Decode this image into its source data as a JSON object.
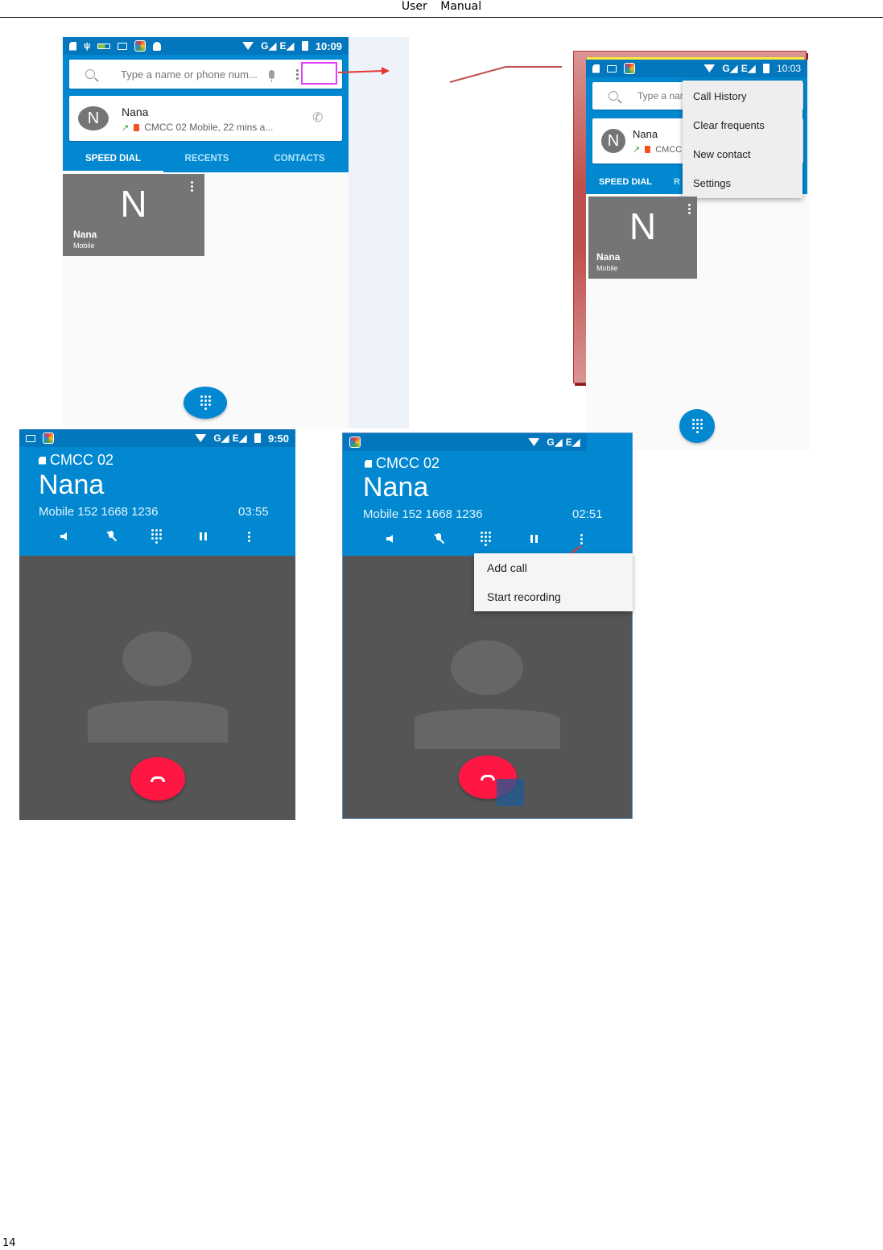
{
  "page": {
    "header_words": [
      "User",
      "Manual"
    ],
    "page_number": "14"
  },
  "colors": {
    "primary_blue": "#0288d1",
    "statusbar_blue": "#0277bd",
    "end_call_red": "#ff1744",
    "highlight_magenta": "#e040fb",
    "annotation_red": "#e53935"
  },
  "screen1": {
    "status_time": "10:09",
    "status_icons": [
      "sim-icon",
      "usb-icon",
      "battery-saver-icon",
      "gallery-icon",
      "app-icon",
      "android-icon"
    ],
    "status_network": "G◢ E◢",
    "search_placeholder": "Type a name or phone num...",
    "recent": {
      "avatar_letter": "N",
      "name": "Nana",
      "direction_glyph": "↗",
      "detail": "CMCC 02 Mobile, 22 mins a..."
    },
    "tabs": [
      {
        "label": "SPEED DIAL",
        "active": true
      },
      {
        "label": "RECENTS",
        "active": false
      },
      {
        "label": "CONTACTS",
        "active": false
      }
    ],
    "speed_dial": {
      "letter": "N",
      "name": "Nana",
      "type": "Mobile"
    }
  },
  "screen2": {
    "status_time": "10:03",
    "status_network": "G◢ E◢",
    "search_placeholder": "Type a name",
    "recent": {
      "avatar_letter": "N",
      "name": "Nana",
      "direction_glyph": "↗",
      "detail": "CMCC"
    },
    "tabs": [
      {
        "label": "SPEED DIAL",
        "active": true
      },
      {
        "label": "R",
        "active": false
      }
    ],
    "menu_items": [
      "Call History",
      "Clear frequents",
      "New contact",
      "Settings"
    ],
    "speed_dial": {
      "letter": "N",
      "name": "Nana",
      "type": "Mobile"
    }
  },
  "screen3": {
    "status_time": "9:50",
    "status_network": "G◢ E◢",
    "sim_label": "CMCC 02",
    "caller_name": "Nana",
    "caller_number": "Mobile 152 1668 1236",
    "call_timer": "03:55"
  },
  "screen4": {
    "status_network": "G◢ E◢",
    "sim_label": "CMCC 02",
    "caller_name": "Nana",
    "caller_number": "Mobile 152 1668 1236",
    "call_timer": "02:51",
    "menu_items": [
      "Add call",
      "Start recording"
    ]
  }
}
